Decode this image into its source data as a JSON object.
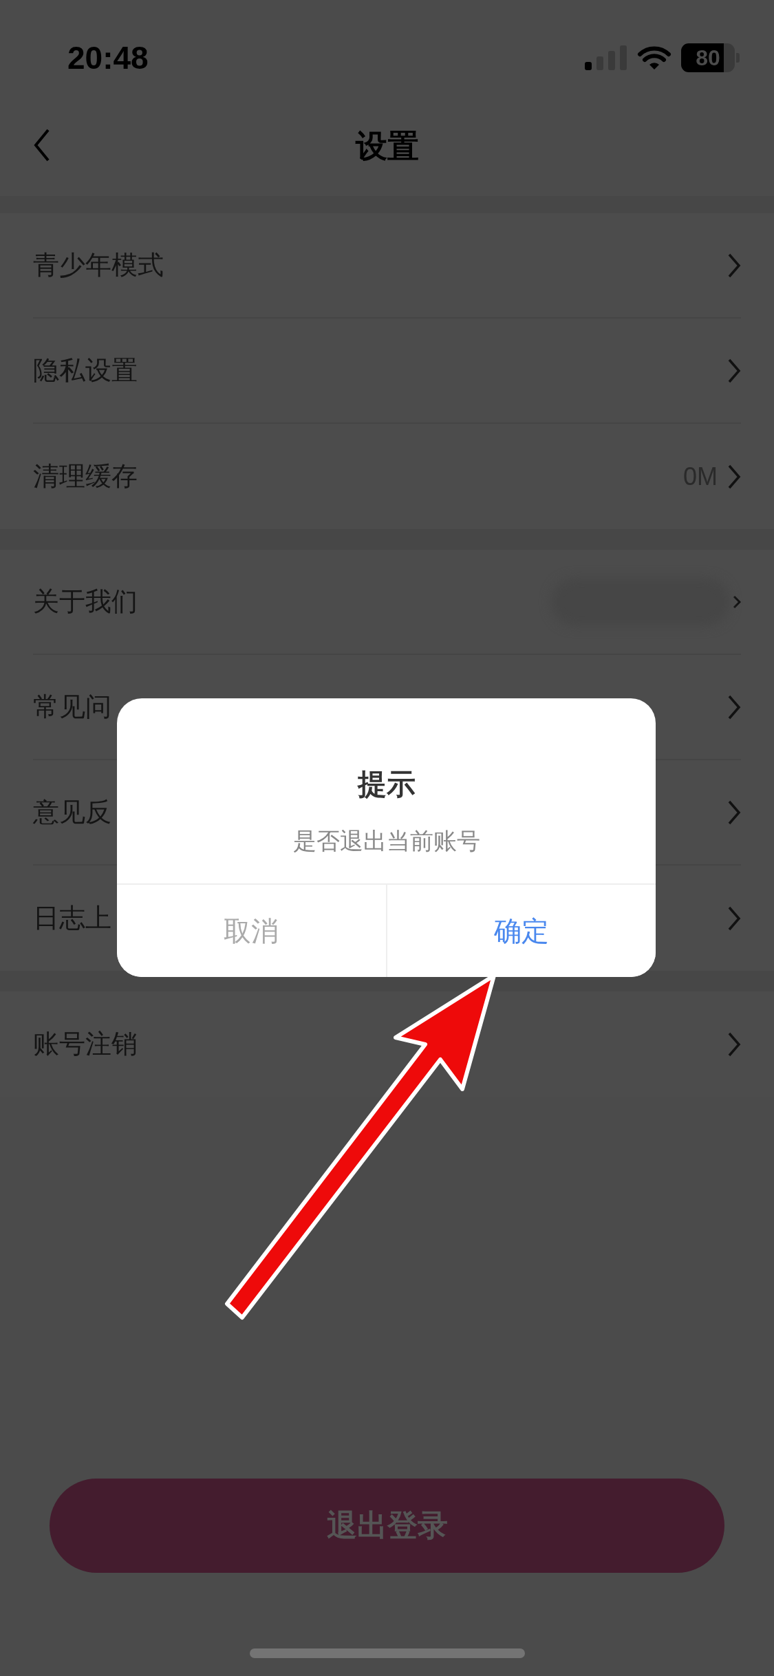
{
  "status_bar": {
    "time": "20:48",
    "battery": "80"
  },
  "nav": {
    "title": "设置"
  },
  "groups": [
    {
      "items": [
        {
          "label": "青少年模式",
          "kind": "link"
        },
        {
          "label": "隐私设置",
          "kind": "link"
        },
        {
          "label": "清理缓存",
          "kind": "value",
          "value": "0M"
        }
      ]
    },
    {
      "items": [
        {
          "label": "关于我们",
          "kind": "redacted"
        },
        {
          "label": "常见问",
          "kind": "link"
        },
        {
          "label": "意见反",
          "kind": "link"
        },
        {
          "label": "日志上",
          "kind": "link"
        }
      ]
    },
    {
      "items": [
        {
          "label": "账号注销",
          "kind": "link"
        }
      ]
    }
  ],
  "logout_button": {
    "label": "退出登录"
  },
  "dialog": {
    "title": "提示",
    "message": "是否退出当前账号",
    "buttons": [
      {
        "label": "取消",
        "kind": "cancel"
      },
      {
        "label": "确定",
        "kind": "confirm"
      }
    ]
  }
}
